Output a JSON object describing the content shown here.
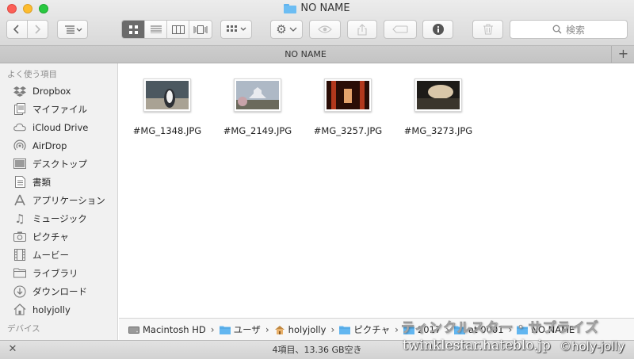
{
  "window": {
    "title": "NO NAME"
  },
  "toolbar": {
    "back_icon": "chevron-left-icon",
    "forward_icon": "chevron-right-icon",
    "arrange_icon": "arrange-list-icon",
    "view_modes": [
      "icon-view",
      "list-view",
      "column-view",
      "cover-flow-view"
    ],
    "active_view": "icon-view",
    "group_icon": "group-grid-icon",
    "action_icon": "gear-icon",
    "quicklook_icon": "eye-icon",
    "share_icon": "share-icon",
    "tag_icon": "tag-icon",
    "info_icon": "info-icon",
    "trash_icon": "trash-icon",
    "search_placeholder": "検索"
  },
  "tabbar": {
    "title": "NO NAME",
    "add_label": "+"
  },
  "sidebar": {
    "favorites_heading": "よく使う項目",
    "items": [
      {
        "label": "Dropbox",
        "icon": "dropbox-icon"
      },
      {
        "label": "マイファイル",
        "icon": "all-my-files-icon"
      },
      {
        "label": "iCloud Drive",
        "icon": "cloud-icon"
      },
      {
        "label": "AirDrop",
        "icon": "airdrop-icon"
      },
      {
        "label": "デスクトップ",
        "icon": "desktop-icon"
      },
      {
        "label": "書類",
        "icon": "documents-icon"
      },
      {
        "label": "アプリケーション",
        "icon": "applications-icon"
      },
      {
        "label": "ミュージック",
        "icon": "music-note-icon"
      },
      {
        "label": "ピクチャ",
        "icon": "camera-icon"
      },
      {
        "label": "ムービー",
        "icon": "film-icon"
      },
      {
        "label": "ライブラリ",
        "icon": "folder-icon"
      },
      {
        "label": "ダウンロード",
        "icon": "download-icon"
      },
      {
        "label": "holyjolly",
        "icon": "home-icon"
      }
    ],
    "devices_heading": "デバイス"
  },
  "files": [
    {
      "name": "#MG_1348.JPG",
      "thumb_colors": [
        "#4c5860",
        "#a9a294",
        "#2d3035"
      ]
    },
    {
      "name": "#MG_2149.JPG",
      "thumb_colors": [
        "#aeb9c6",
        "#e9ebef",
        "#6b6a5c"
      ]
    },
    {
      "name": "#MG_3257.JPG",
      "thumb_colors": [
        "#2a0d06",
        "#b2381c",
        "#e4a36c"
      ]
    },
    {
      "name": "#MG_3273.JPG",
      "thumb_colors": [
        "#1d1b18",
        "#d9c7a9",
        "#3a352c"
      ]
    }
  ],
  "pathbar": {
    "crumbs": [
      {
        "label": "Macintosh HD",
        "icon": "hard-drive-icon"
      },
      {
        "label": "ユーザ",
        "icon": "folder-icon"
      },
      {
        "label": "holyjolly",
        "icon": "home-icon"
      },
      {
        "label": "ピクチャ",
        "icon": "folder-icon"
      },
      {
        "label": "2017",
        "icon": "folder-icon"
      },
      {
        "label": "at 0001",
        "icon": "folder-icon"
      },
      {
        "label": "NO NAME",
        "icon": "folder-icon"
      }
    ]
  },
  "status": {
    "text": "4項目、13.36 GB空き"
  },
  "watermark": {
    "top": "ティンクルスター・サプライズ",
    "blog": "twinklestar.hateblo.jp",
    "user": "©holy-jolly"
  }
}
